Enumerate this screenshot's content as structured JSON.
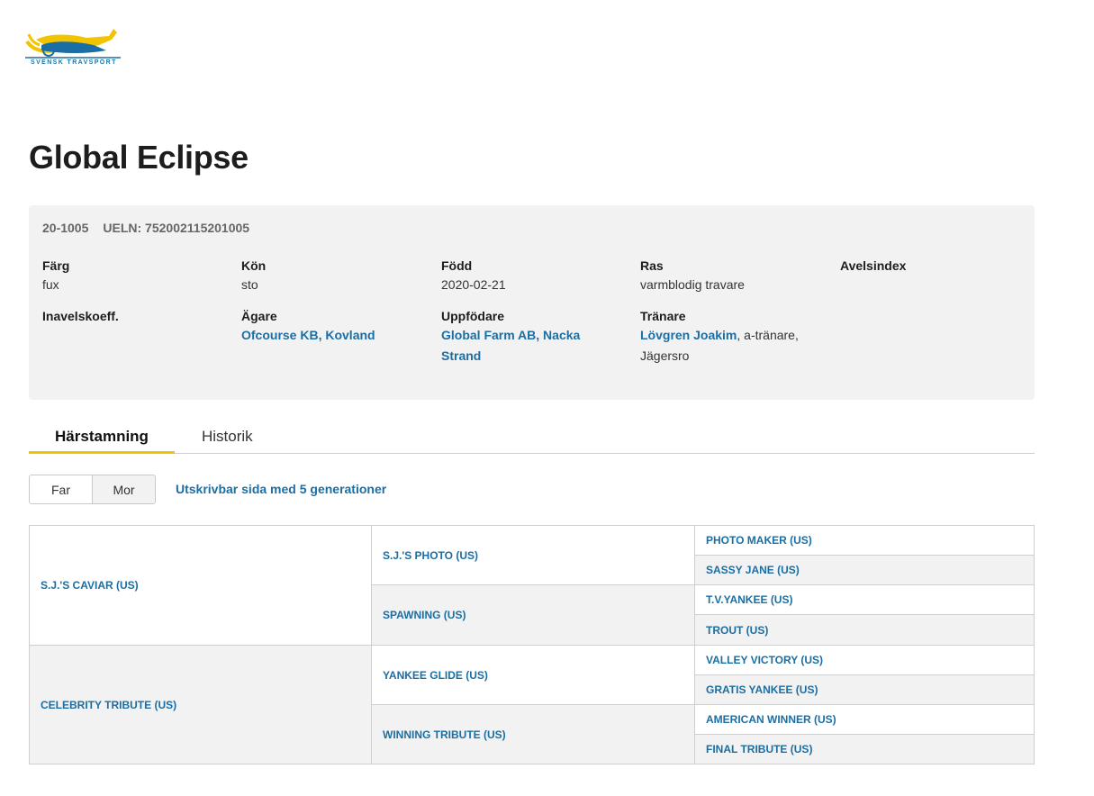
{
  "logo": {
    "text": "SVENSK TRAVSPORT"
  },
  "horse": {
    "name": "Global Eclipse"
  },
  "ids": {
    "reg": "20-1005",
    "ueln": "UELN: 752002115201005"
  },
  "fields": {
    "farg": {
      "label": "Färg",
      "value": "fux"
    },
    "kon": {
      "label": "Kön",
      "value": "sto"
    },
    "fodd": {
      "label": "Född",
      "value": "2020-02-21"
    },
    "ras": {
      "label": "Ras",
      "value": "varmblodig travare"
    },
    "avelsindex": {
      "label": "Avelsindex"
    },
    "inavel": {
      "label": "Inavelskoeff."
    },
    "agare": {
      "label": "Ägare",
      "value": "Ofcourse KB, Kovland"
    },
    "uppfodare": {
      "label": "Uppfödare",
      "line1": "Global Farm AB, Nacka",
      "line2": "Strand"
    },
    "tranare": {
      "label": "Tränare",
      "name": "Lövgren Joakim",
      "suffix": ", a-tränare,",
      "line2": "Jägersro"
    }
  },
  "tabs": {
    "pedigree": "Härstamning",
    "history": "Historik"
  },
  "toggle": {
    "sire": "Far",
    "dam": "Mor"
  },
  "print_link": "Utskrivbar sida med 5 generationer",
  "pedigree": {
    "gen1": [
      "S.J.'S CAVIAR (US)",
      "CELEBRITY TRIBUTE (US)"
    ],
    "gen2": [
      "S.J.'S PHOTO (US)",
      "SPAWNING (US)",
      "YANKEE GLIDE (US)",
      "WINNING TRIBUTE (US)"
    ],
    "gen3": [
      "PHOTO MAKER (US)",
      "SASSY JANE (US)",
      "T.V.YANKEE (US)",
      "TROUT (US)",
      "VALLEY VICTORY (US)",
      "GRATIS YANKEE (US)",
      "AMERICAN WINNER (US)",
      "FINAL TRIBUTE (US)"
    ]
  },
  "colors": {
    "accent": "#f2c400",
    "link": "#1b6ea3",
    "panel": "#f2f2f2"
  }
}
